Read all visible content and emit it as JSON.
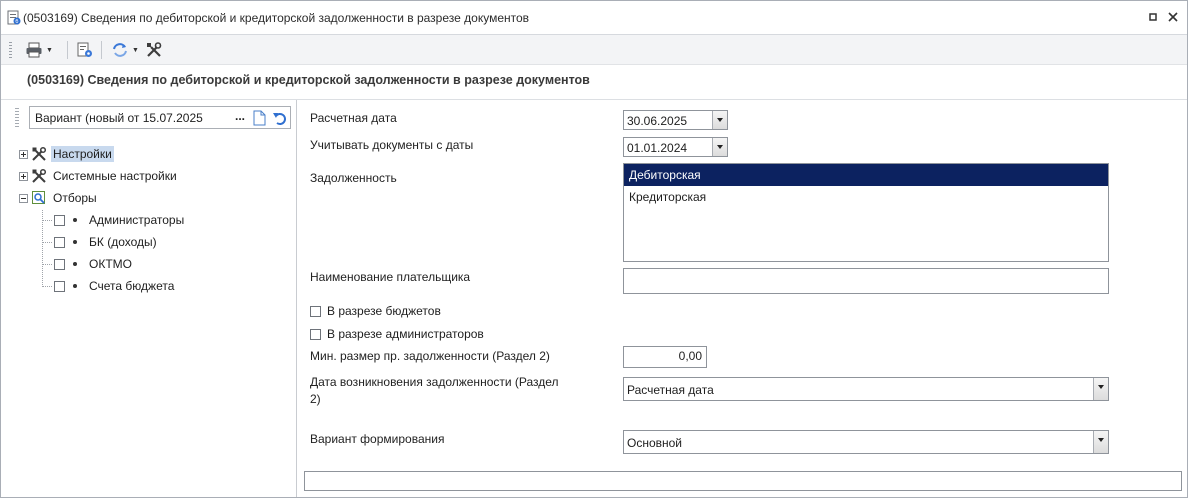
{
  "window": {
    "title": "(0503169) Сведения по дебиторской и кредиторской задолженности в разрезе документов",
    "restore_glyph": "▫",
    "close_glyph": "✕"
  },
  "toolbar": {
    "print_icon": "printer-icon",
    "settings_icon": "report-settings-icon",
    "refresh_icon": "refresh-options-icon",
    "tools_icon": "tools-icon"
  },
  "heading": "(0503169) Сведения по дебиторской и кредиторской задолженности в разрезе документов",
  "variant": {
    "value": "Вариант (новый от 15.07.2025",
    "dots": "..."
  },
  "tree": {
    "settings": "Настройки",
    "system_settings": "Системные настройки",
    "filters": "Отборы",
    "filter_items": [
      "Администраторы",
      "БК (доходы)",
      "ОКТМО",
      "Счета бюджета"
    ]
  },
  "form": {
    "calc_date_label": "Расчетная дата",
    "calc_date_value": "30.06.2025",
    "docs_from_label": "Учитывать документы с даты",
    "docs_from_value": "01.01.2024",
    "debt_label": "Задолженность",
    "debt_options": [
      "Дебиторская",
      "Кредиторская"
    ],
    "payer_label": "Наименование плательщика",
    "payer_value": "",
    "by_budgets_label": "В разрезе бюджетов",
    "by_admins_label": "В разрезе администраторов",
    "min_debt_label": "Мин. размер пр. задолженности (Раздел 2)",
    "min_debt_value": "0,00",
    "debt_date_label_1": "Дата возникновения задолженности (Раздел",
    "debt_date_label_2": "2)",
    "debt_date_value": "Расчетная дата",
    "variant_label": "Вариант формирования",
    "variant_value": "Основной"
  },
  "colors": {
    "selection": "#0c2260",
    "tree_selection": "#c8d9ee",
    "accent_blue": "#2f6fd0"
  }
}
